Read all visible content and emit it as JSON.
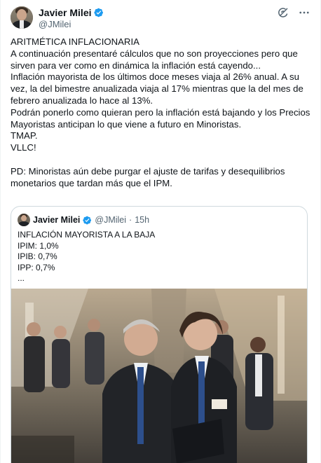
{
  "tweet": {
    "author": {
      "display_name": "Javier Milei",
      "handle": "@JMilei",
      "verified": true
    },
    "icons": {
      "grok": "grok-icon",
      "more": "more-options-icon",
      "verified": "verified-badge-icon"
    },
    "text_lines": [
      "ARITMÉTICA INFLACIONARIA",
      "A continuación presentaré cálculos que no son proyecciones pero que",
      "sirven para ver como en dinámica la inflación está cayendo...",
      "Inflación mayorista de los últimos doce meses viaja al 26% anual.  A su",
      "vez, la del bimestre anualizada viaja al 17% mientras que la del mes de",
      "febrero anualizada lo hace al 13%.",
      "Podrán ponerlo como quieran pero la inflación está bajando y los Precios",
      "Mayoristas anticipan lo que viene a futuro en Minoristas.",
      "TMAP.",
      "VLLC!",
      "",
      "PD: Minoristas aún debe purgar el ajuste de tarifas y desequilibrios",
      "monetarios que tardan más que el IPM."
    ]
  },
  "quoted_tweet": {
    "author": {
      "display_name": "Javier Milei",
      "handle": "@JMilei",
      "separator": "·",
      "time": "15h",
      "verified": true
    },
    "text_lines": [
      "INFLACIÓN MAYORISTA A LA BAJA",
      "IPIM: 1,0%",
      "IPIB: 0,7%",
      "IPP: 0,7%",
      "..."
    ],
    "has_photo": true
  },
  "colors": {
    "text": "#0f1419",
    "secondary": "#536471",
    "verified": "#1d9bf0",
    "border": "#cfd9de"
  }
}
